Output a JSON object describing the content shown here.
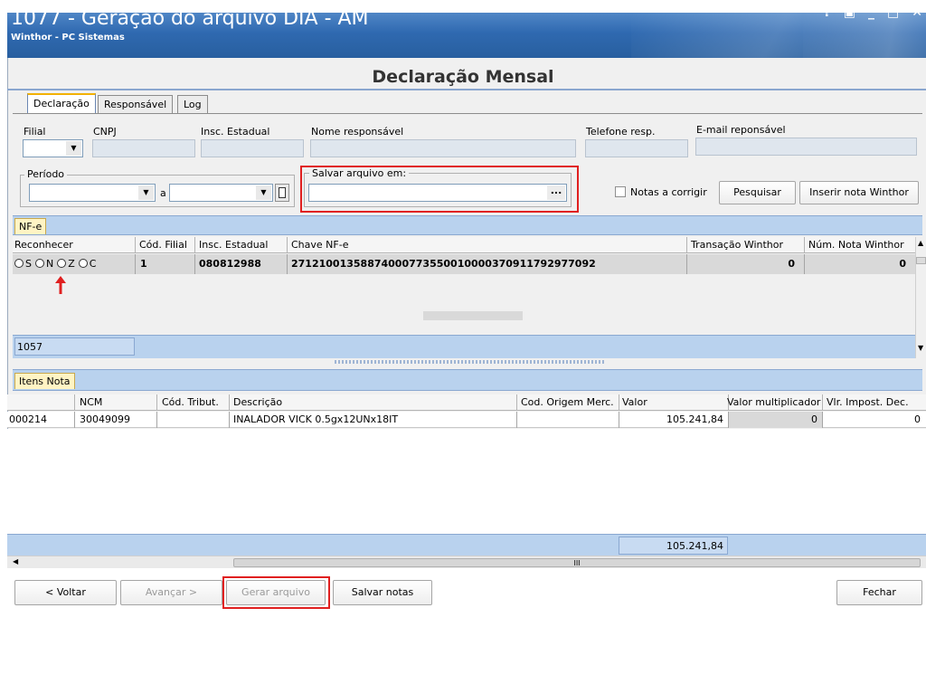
{
  "window": {
    "title": "1077 - Geração do arquivo DIA - AM",
    "subtitle": "Winthor - PC Sistemas",
    "controls": [
      "?",
      "▣",
      "_",
      "□",
      "✕"
    ]
  },
  "form_title": "Declaração Mensal",
  "tabs": [
    {
      "label": "Declaração",
      "active": true
    },
    {
      "label": "Responsável",
      "active": false
    },
    {
      "label": "Log",
      "active": false
    }
  ],
  "fields": {
    "filial_label": "Filial",
    "cnpj_label": "CNPJ",
    "insc_estadual_label": "Insc. Estadual",
    "nome_responsavel_label": "Nome responsável",
    "telefone_label": "Telefone resp.",
    "email_label": "E-mail reponsável",
    "periodo_label": "Período",
    "periodo_sep": "a",
    "salvar_label": "Salvar arquivo em:",
    "salvar_browse": "...",
    "notas_corrigir_label": "Notas a corrigir"
  },
  "buttons": {
    "pesquisar": "Pesquisar",
    "inserir_nota": "Inserir nota Winthor",
    "voltar": "< Voltar",
    "avancar": "Avançar >",
    "gerar_arquivo": "Gerar arquivo",
    "salvar_notas": "Salvar notas",
    "fechar": "Fechar"
  },
  "nfe_panel": {
    "tab": "NF-e",
    "columns": [
      "Reconhecer",
      "Cód. Filial",
      "Insc. Estadual",
      "Chave NF-e",
      "Transação Winthor",
      "Núm. Nota Winthor"
    ],
    "radio_options": [
      "S",
      "N",
      "Z",
      "C"
    ],
    "rows": [
      {
        "cod_filial": "1",
        "insc_estadual": "080812988",
        "chave": "27121001358874000773550010000370911792977092",
        "transacao": "0",
        "num_nota": "0"
      }
    ],
    "footer_count": "1057"
  },
  "itens_panel": {
    "tab": "Itens Nota",
    "columns": [
      "NCM",
      "Cód. Tribut.",
      "Descrição",
      "Cod. Origem Merc.",
      "Valor",
      "Valor multiplicador",
      "Vlr. Impost. Dec."
    ],
    "rows": [
      {
        "code": "000214",
        "ncm": "30049099",
        "cod_tribut": "",
        "descricao": "INALADOR VICK 0.5gx12UNx18IT",
        "origem": "",
        "valor": "105.241,84",
        "multiplicador": "0",
        "impost": "0"
      }
    ],
    "footer_total": "105.241,84",
    "hscroll_mark": "III"
  },
  "colors": {
    "titlebar": "#2f69b0",
    "highlight": "#e02020",
    "arrow": "#e02020"
  }
}
